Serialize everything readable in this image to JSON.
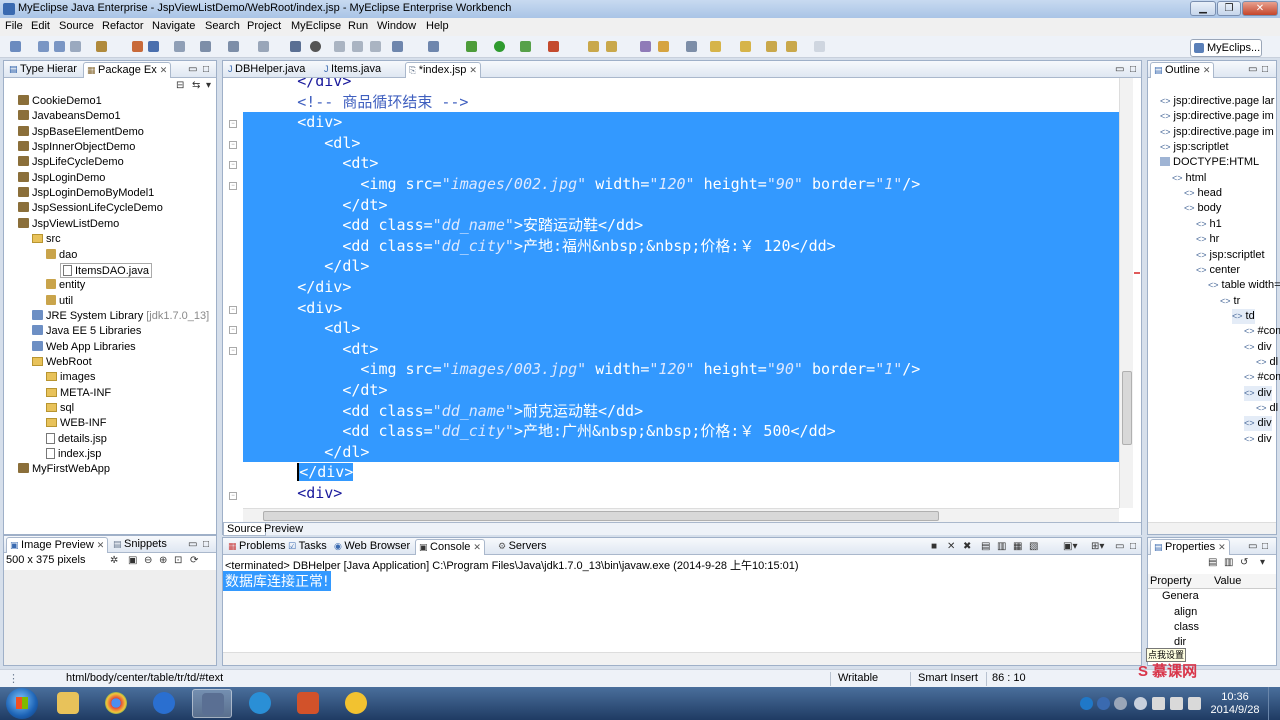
{
  "window": {
    "title": "MyEclipse Java Enterprise - JspViewListDemo/WebRoot/index.jsp - MyEclipse Enterprise Workbench",
    "minimize": "▁",
    "restore": "❐",
    "close": "✕"
  },
  "menu": [
    "File",
    "Edit",
    "Source",
    "Refactor",
    "Navigate",
    "Search",
    "Project",
    "MyEclipse",
    "Run",
    "Window",
    "Help"
  ],
  "perspective": {
    "label": "MyEclips..."
  },
  "left_panel": {
    "tabs": [
      "Type Hierar",
      "Package Ex"
    ],
    "items": [
      {
        "label": "CookieDemo1",
        "icon": "project-icon"
      },
      {
        "label": "JavabeansDemo1",
        "icon": "project-icon"
      },
      {
        "label": "JspBaseElementDemo",
        "icon": "project-icon"
      },
      {
        "label": "JspInnerObjectDemo",
        "icon": "project-icon"
      },
      {
        "label": "JspLifeCycleDemo",
        "icon": "project-icon"
      },
      {
        "label": "JspLoginDemo",
        "icon": "project-icon"
      },
      {
        "label": "JspLoginDemoByModel1",
        "icon": "project-icon"
      },
      {
        "label": "JspSessionLifeCycleDemo",
        "icon": "project-icon"
      },
      {
        "label": "JspViewListDemo",
        "icon": "project-icon"
      },
      {
        "label": "src",
        "icon": "folder-icon"
      },
      {
        "label": "dao",
        "icon": "package-icon"
      },
      {
        "label": "ItemsDAO.java",
        "icon": "file-icon"
      },
      {
        "label": "entity",
        "icon": "package-icon"
      },
      {
        "label": "util",
        "icon": "package-icon"
      },
      {
        "label": "JRE System Library",
        "suffix": "[jdk1.7.0_13]",
        "icon": "library-icon"
      },
      {
        "label": "Java EE 5 Libraries",
        "icon": "library-icon"
      },
      {
        "label": "Web App Libraries",
        "icon": "library-icon"
      },
      {
        "label": "WebRoot",
        "icon": "folder-icon"
      },
      {
        "label": "images",
        "icon": "folder-icon"
      },
      {
        "label": "META-INF",
        "icon": "folder-icon"
      },
      {
        "label": "sql",
        "icon": "folder-icon"
      },
      {
        "label": "WEB-INF",
        "icon": "folder-icon"
      },
      {
        "label": "details.jsp",
        "icon": "file-icon"
      },
      {
        "label": "index.jsp",
        "icon": "file-icon"
      },
      {
        "label": "MyFirstWebApp",
        "icon": "project-icon"
      }
    ]
  },
  "image_preview": {
    "tabs": [
      "Image Preview",
      "Snippets"
    ],
    "size_label": "500 x 375 pixels"
  },
  "editor": {
    "tabs": [
      "DBHelper.java",
      "Items.java",
      "*index.jsp"
    ],
    "bottom_tabs": [
      "Source",
      "Preview"
    ],
    "lines": [
      {
        "indent": "      ",
        "text": "</div>",
        "selected": false
      },
      {
        "indent": "      ",
        "text": "<!-- 商品循环结束 -->",
        "selected": false,
        "comment": true
      },
      {
        "indent": "      ",
        "text": "<div>",
        "selected": true
      },
      {
        "indent": "         ",
        "text": "<dl>",
        "selected": true
      },
      {
        "indent": "           ",
        "text": "<dt>",
        "selected": true
      },
      {
        "indent": "             ",
        "pre": "<img src=",
        "v1": "\"images/002.jpg\"",
        "mid1": " width=",
        "v2": "\"120\"",
        "mid2": " height=",
        "v3": "\"90\"",
        "mid3": " border=",
        "v4": "\"1\"",
        "post": "/>",
        "selected": true,
        "img": true
      },
      {
        "indent": "           ",
        "text": "</dt>",
        "selected": true
      },
      {
        "indent": "           ",
        "pre": "<dd class=",
        "v1": "\"dd_name\"",
        "post": ">安踏运动鞋</dd>",
        "selected": true,
        "dd": true
      },
      {
        "indent": "           ",
        "pre": "<dd class=",
        "v1": "\"dd_city\"",
        "post": ">产地:福州&nbsp;&nbsp;价格:￥ 120</dd>",
        "selected": true,
        "dd": true
      },
      {
        "indent": "         ",
        "text": "</dl>",
        "selected": true
      },
      {
        "indent": "      ",
        "text": "</div>",
        "selected": true
      },
      {
        "indent": "      ",
        "text": "<div>",
        "selected": true
      },
      {
        "indent": "         ",
        "text": "<dl>",
        "selected": true
      },
      {
        "indent": "           ",
        "text": "<dt>",
        "selected": true
      },
      {
        "indent": "             ",
        "pre": "<img src=",
        "v1": "\"images/003.jpg\"",
        "mid1": " width=",
        "v2": "\"120\"",
        "mid2": " height=",
        "v3": "\"90\"",
        "mid3": " border=",
        "v4": "\"1\"",
        "post": "/>",
        "selected": true,
        "img": true
      },
      {
        "indent": "           ",
        "text": "</dt>",
        "selected": true
      },
      {
        "indent": "           ",
        "pre": "<dd class=",
        "v1": "\"dd_name\"",
        "post": ">耐克运动鞋</dd>",
        "selected": true,
        "dd": true
      },
      {
        "indent": "           ",
        "pre": "<dd class=",
        "v1": "\"dd_city\"",
        "post": ">产地:广州&nbsp;&nbsp;价格:￥ 500</dd>",
        "selected": true,
        "dd": true
      },
      {
        "indent": "         ",
        "text": "</dl>",
        "selected": true
      },
      {
        "indent": "      ",
        "text": "</div>",
        "selected": "partial"
      },
      {
        "indent": "      ",
        "text": "<div>",
        "selected": false
      }
    ]
  },
  "outline": {
    "tab": "Outline",
    "items": [
      {
        "label": "jsp:directive.page lar",
        "icon": "tag"
      },
      {
        "label": "jsp:directive.page im",
        "icon": "tag"
      },
      {
        "label": "jsp:directive.page im",
        "icon": "tag"
      },
      {
        "label": "jsp:scriptlet",
        "icon": "tag"
      },
      {
        "label": "DOCTYPE:HTML",
        "icon": "doc"
      },
      {
        "label": "html",
        "icon": "tag"
      },
      {
        "label": "head",
        "icon": "tag"
      },
      {
        "label": "body",
        "icon": "tag"
      },
      {
        "label": "h1",
        "icon": "tag"
      },
      {
        "label": "hr",
        "icon": "tag"
      },
      {
        "label": "jsp:scriptlet",
        "icon": "tag"
      },
      {
        "label": "center",
        "icon": "tag"
      },
      {
        "label": "table width=",
        "icon": "tag"
      },
      {
        "label": "tr",
        "icon": "tag"
      },
      {
        "label": "td",
        "icon": "tag"
      },
      {
        "label": "#com",
        "icon": "tag"
      },
      {
        "label": "div",
        "icon": "tag"
      },
      {
        "label": "dl",
        "icon": "tag"
      },
      {
        "label": "#com",
        "icon": "tag"
      },
      {
        "label": "div",
        "icon": "tag"
      },
      {
        "label": "dl",
        "icon": "tag"
      },
      {
        "label": "div",
        "icon": "tag"
      },
      {
        "label": "div",
        "icon": "tag"
      }
    ]
  },
  "console": {
    "tabs": [
      "Problems",
      "Tasks",
      "Web Browser",
      "Console",
      "Servers"
    ],
    "terminated": "<terminated> DBHelper [Java Application] C:\\Program Files\\Java\\jdk1.7.0_13\\bin\\javaw.exe (2014-9-28 上午10:15:01)",
    "output": "数据库连接正常!"
  },
  "properties": {
    "tab": "Properties",
    "col_property": "Property",
    "col_value": "Value",
    "rows": [
      "Genera",
      "align",
      "class",
      "dir"
    ]
  },
  "tooltip": "点我设置",
  "status": {
    "path": "html/body/center/table/tr/td/#text",
    "writable": "Writable",
    "insert_mode": "Smart Insert",
    "position": "86 : 10"
  },
  "taskbar": {
    "clock_time": "10:36",
    "clock_date": "2014/9/28"
  },
  "watermark": "S 慕课网",
  "colors": {
    "selection": "#3399ff",
    "tag_text": "#1a1a9c",
    "attr_value": "#2a00ff"
  }
}
